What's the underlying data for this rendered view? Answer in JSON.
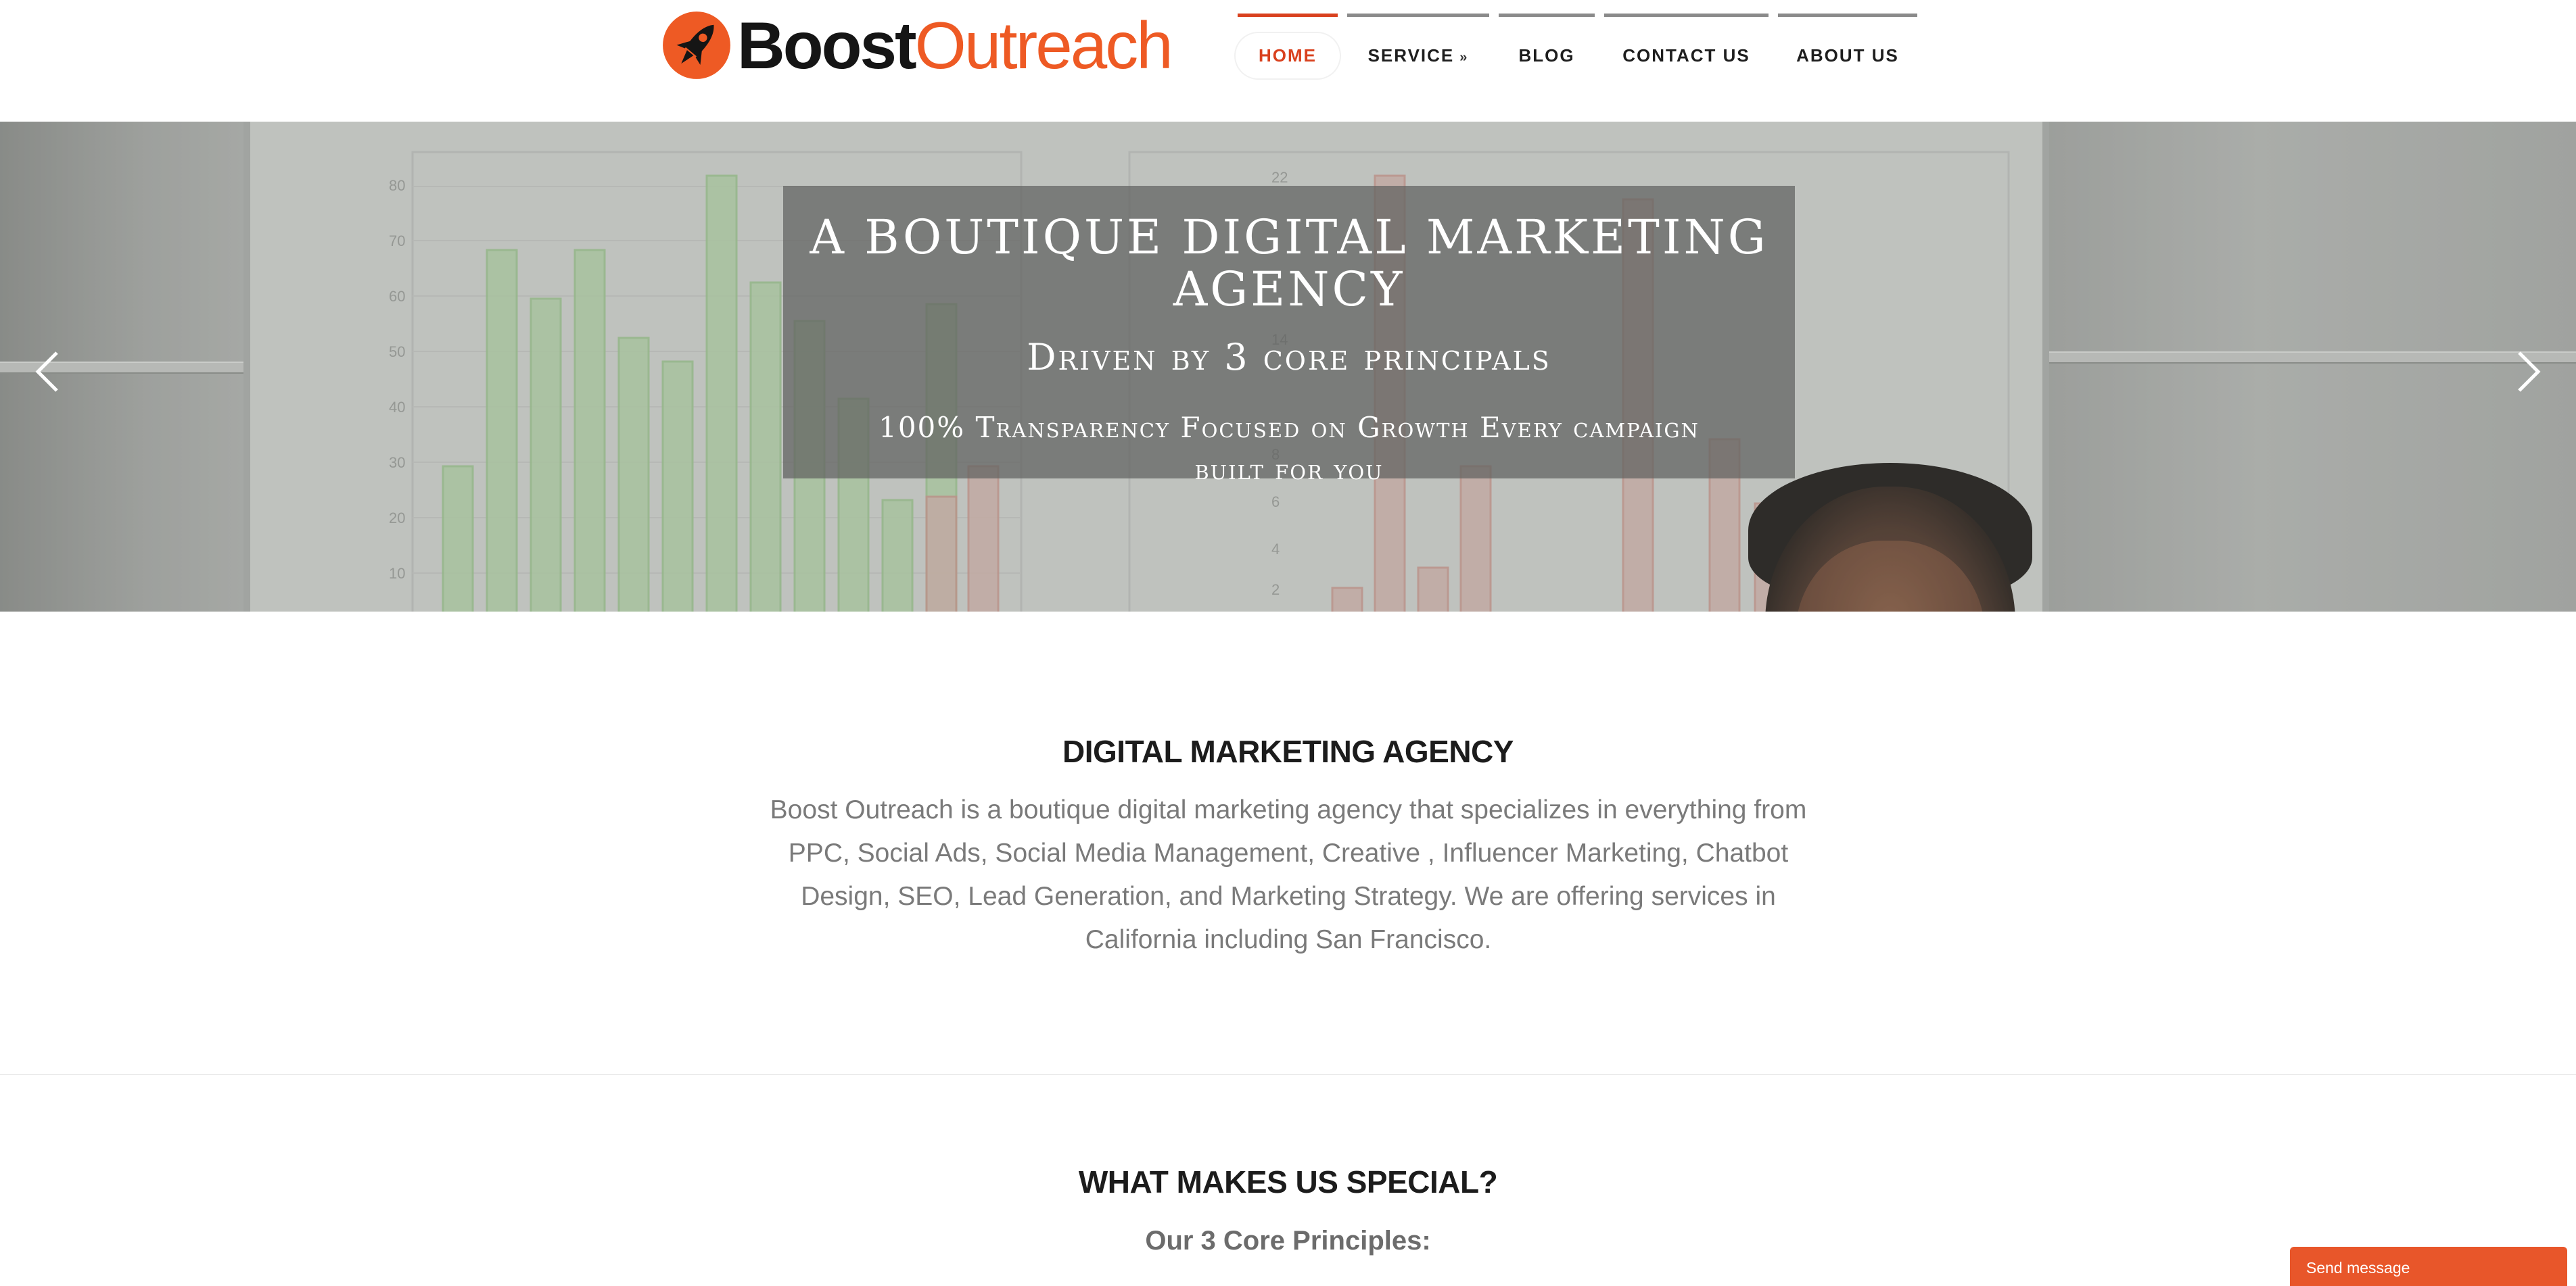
{
  "brand": {
    "name_part1": "Boost",
    "name_part2": "Outreach",
    "accent_color": "#ee5a24",
    "logo_icon": "rocket-icon"
  },
  "nav": {
    "items": [
      {
        "label": "HOME",
        "active": true
      },
      {
        "label": "SERVICE",
        "dropdown": true
      },
      {
        "label": "BLOG"
      },
      {
        "label": "CONTACT US"
      },
      {
        "label": "ABOUT US"
      }
    ],
    "dropdown_icon": "double-chevron-down-icon"
  },
  "hero": {
    "title": "A BOUTIQUE DIGITAL MARKETING AGENCY",
    "subtitle": "Driven by 3 core principals",
    "tagline": "100% Transparency Focused on Growth Every campaign built for you",
    "prev_icon": "chevron-left-icon",
    "next_icon": "chevron-right-icon"
  },
  "intro": {
    "heading": "DIGITAL MARKETING AGENCY",
    "body": "Boost Outreach is a boutique digital marketing agency that specializes in everything from PPC, Social Ads, Social Media Management, Creative , Influencer Marketing, Chatbot Design, SEO, Lead Generation, and Marketing Strategy. We are offering services in California including San Francisco."
  },
  "special": {
    "heading": "WHAT MAKES US SPECIAL?",
    "subheading": "Our 3 Core Principles:"
  },
  "chat": {
    "label": "Send message"
  }
}
